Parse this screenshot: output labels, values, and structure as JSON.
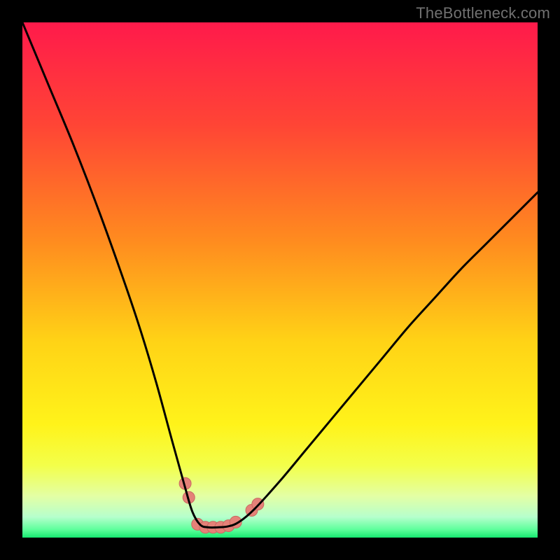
{
  "watermark": "TheBottleneck.com",
  "colors": {
    "black": "#000000",
    "curve": "#000000",
    "marker_fill": "#e48178",
    "marker_stroke": "#c96a61",
    "watermark": "#717171"
  },
  "chart_data": {
    "type": "line",
    "title": "",
    "xlabel": "",
    "ylabel": "",
    "xlim": [
      0,
      100
    ],
    "ylim": [
      0,
      100
    ],
    "gradient_stops": [
      {
        "offset": 0.0,
        "color": "#ff1a4b"
      },
      {
        "offset": 0.2,
        "color": "#ff4535"
      },
      {
        "offset": 0.42,
        "color": "#ff8a1f"
      },
      {
        "offset": 0.62,
        "color": "#ffd316"
      },
      {
        "offset": 0.78,
        "color": "#fff31a"
      },
      {
        "offset": 0.86,
        "color": "#f3ff4a"
      },
      {
        "offset": 0.92,
        "color": "#e3ffa5"
      },
      {
        "offset": 0.96,
        "color": "#b6ffcc"
      },
      {
        "offset": 0.985,
        "color": "#5bff9a"
      },
      {
        "offset": 1.0,
        "color": "#17e870"
      }
    ],
    "series": [
      {
        "name": "bottleneck-curve",
        "x": [
          0,
          5,
          10,
          15,
          20,
          23,
          26,
          29,
          31.5,
          33,
          34.5,
          36,
          38,
          40,
          42,
          45,
          50,
          55,
          60,
          65,
          70,
          75,
          80,
          85,
          90,
          95,
          100
        ],
        "y": [
          100,
          88,
          76,
          63,
          49,
          40,
          30,
          19,
          10,
          5,
          2.5,
          2,
          2,
          2.2,
          3,
          5.5,
          11,
          17,
          23,
          29,
          35,
          41,
          46.5,
          52,
          57,
          62,
          67
        ]
      }
    ],
    "markers": [
      {
        "x": 31.6,
        "y": 10.5
      },
      {
        "x": 32.3,
        "y": 7.8
      },
      {
        "x": 34.0,
        "y": 2.6
      },
      {
        "x": 35.5,
        "y": 2.0
      },
      {
        "x": 37.0,
        "y": 2.0
      },
      {
        "x": 38.5,
        "y": 2.0
      },
      {
        "x": 40.0,
        "y": 2.3
      },
      {
        "x": 41.4,
        "y": 3.0
      },
      {
        "x": 44.5,
        "y": 5.3
      },
      {
        "x": 45.7,
        "y": 6.5
      }
    ],
    "marker_radius_px": 8.5
  }
}
